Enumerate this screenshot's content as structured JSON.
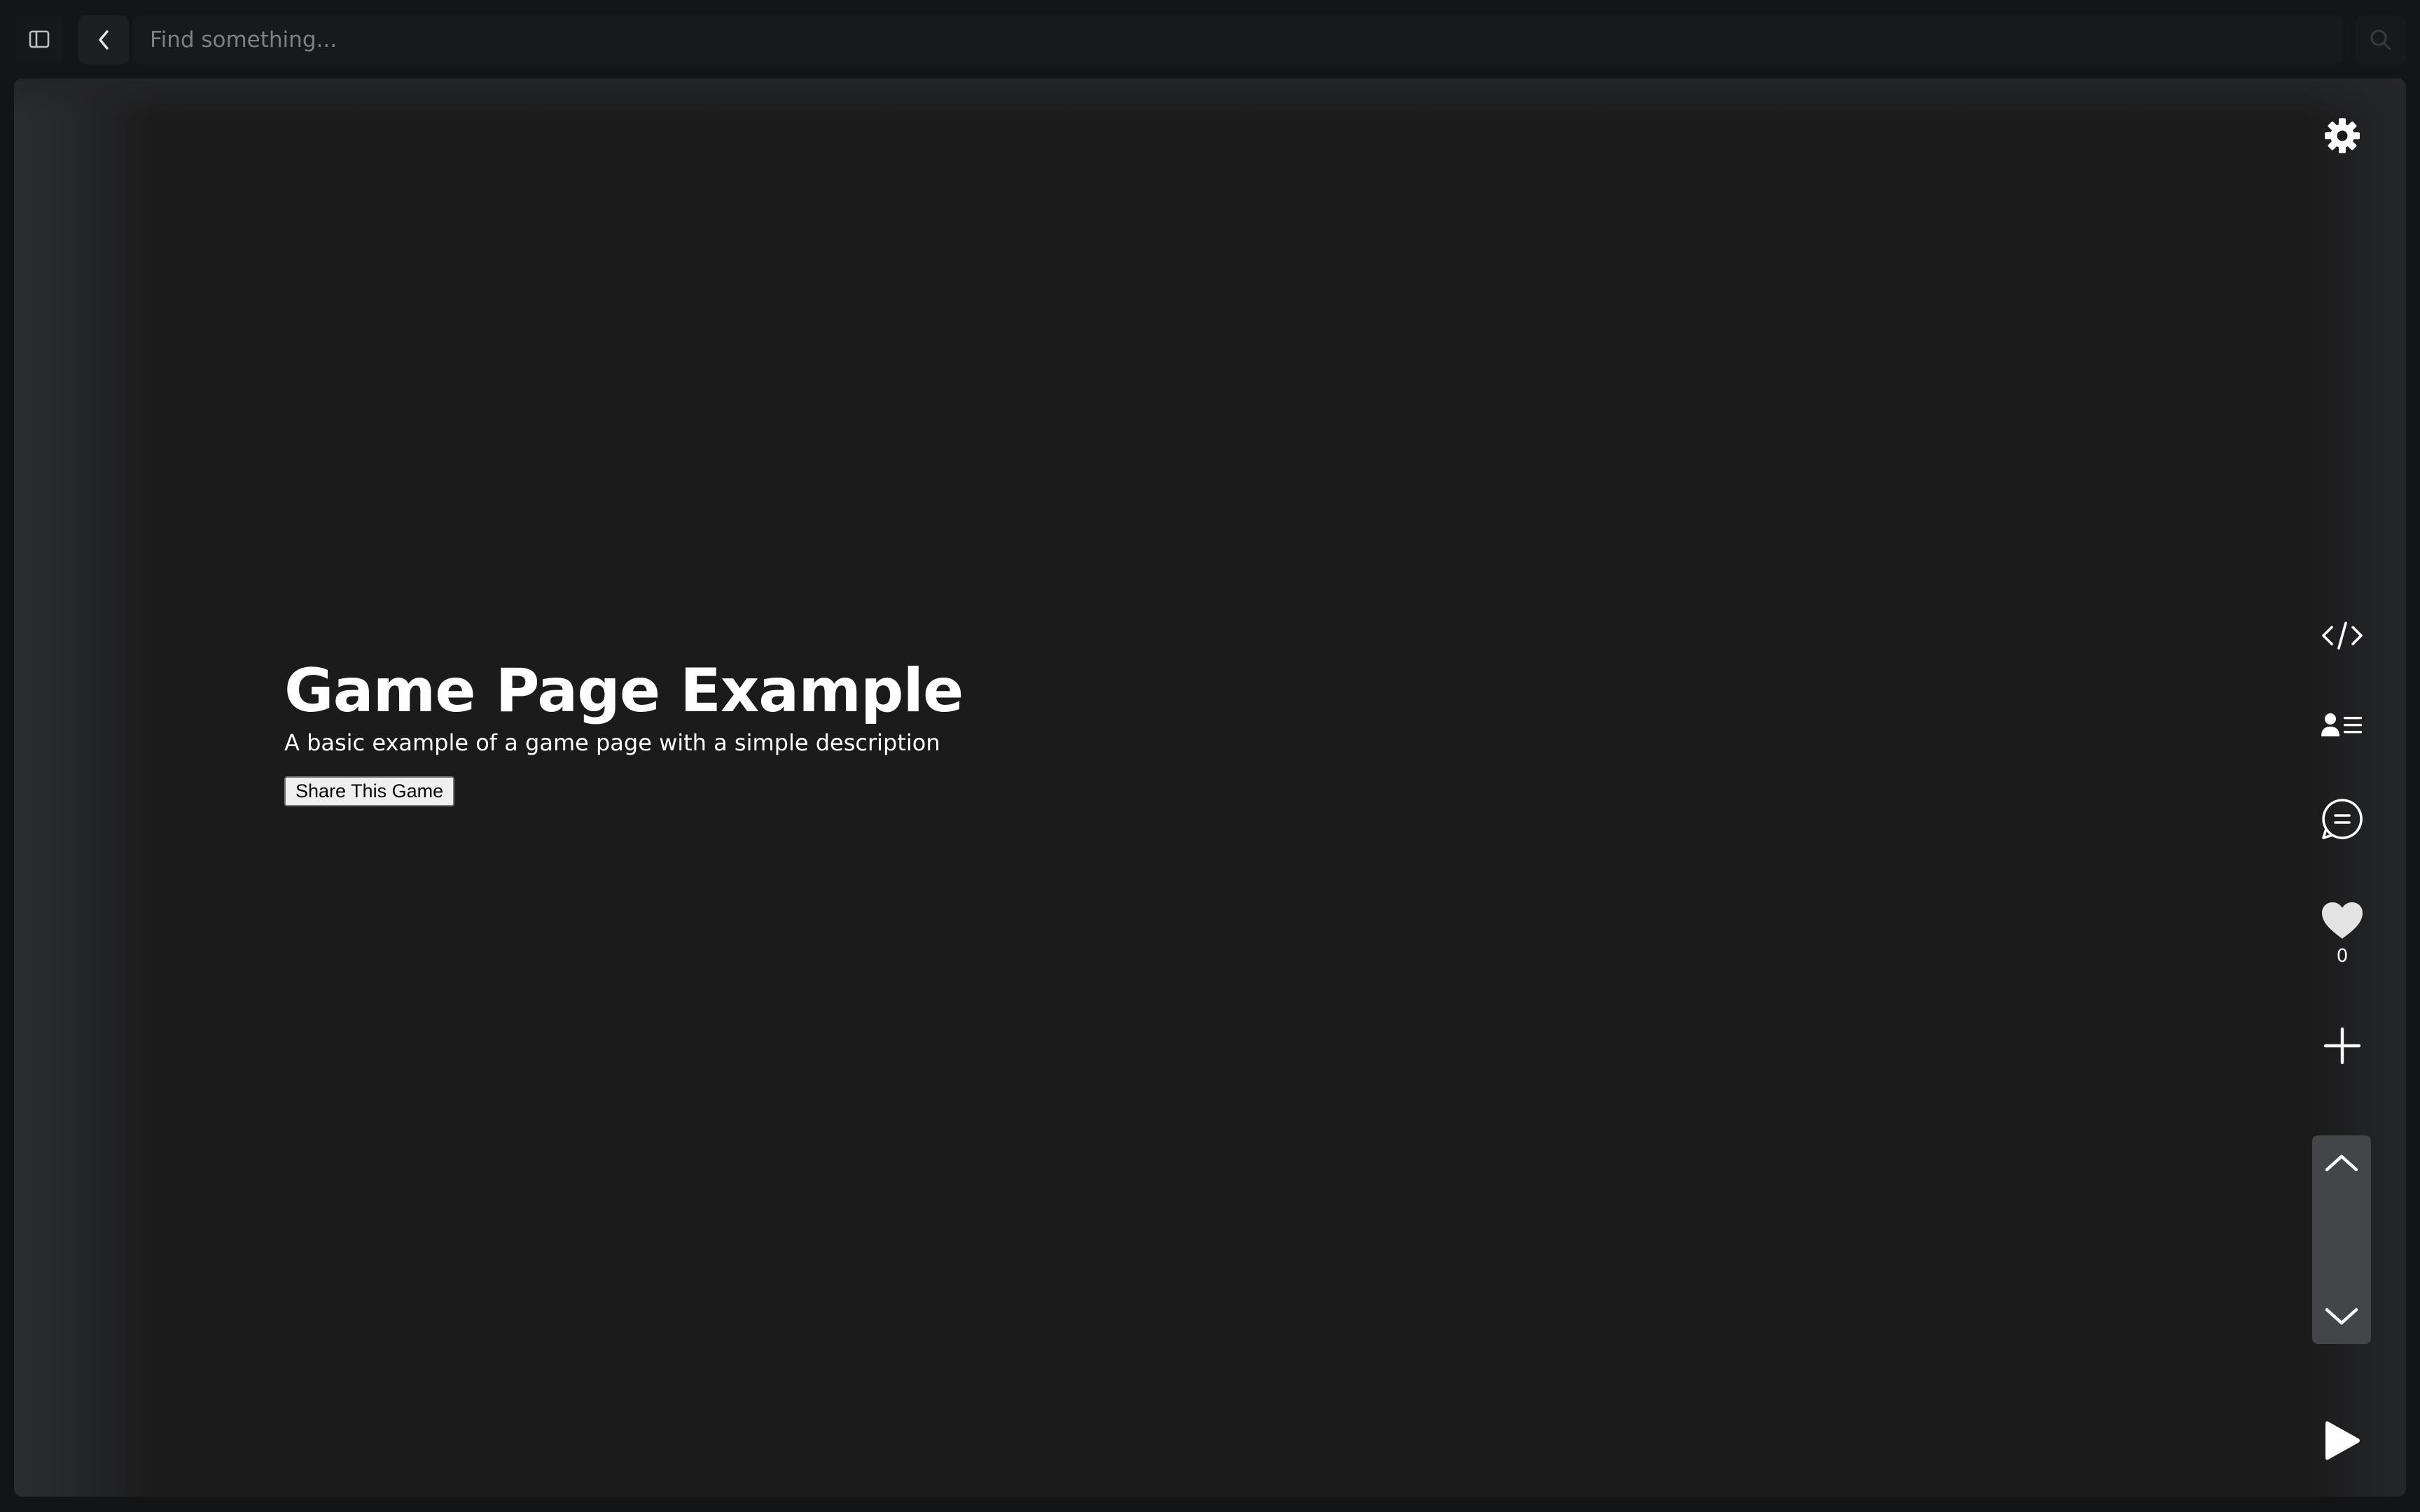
{
  "topbar": {
    "search_placeholder": "Find something..."
  },
  "game": {
    "title": "Game Page Example",
    "description": "A basic example of a game page with a simple description",
    "share_label": "Share This Game"
  },
  "rail": {
    "like_count": "0"
  },
  "colors": {
    "page_bg": "#131416",
    "frame_bg": "#1b1b1c",
    "text": "#ffffff",
    "scroll_group_bg": "#444548"
  },
  "icons": {
    "sidebar": "sidebar-toggle-icon",
    "back": "chevron-left-icon",
    "search": "search-icon",
    "settings": "gear-icon",
    "code": "code-icon",
    "profile": "profile-list-icon",
    "comment": "comment-icon",
    "like": "heart-icon",
    "add": "plus-icon",
    "scroll_up": "chevron-up-icon",
    "scroll_down": "chevron-down-icon",
    "play": "play-icon"
  }
}
